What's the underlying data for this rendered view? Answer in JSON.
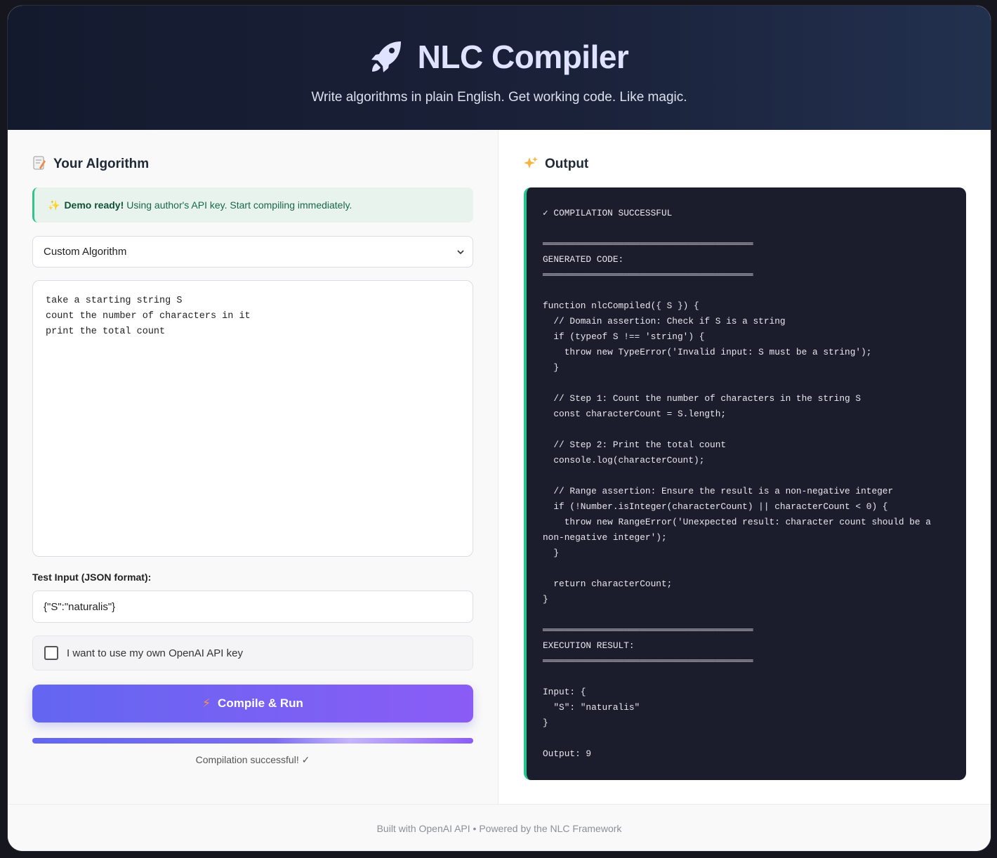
{
  "header": {
    "title": "NLC Compiler",
    "subtitle": "Write algorithms in plain English. Get working code. Like magic."
  },
  "left": {
    "section_title": "Your Algorithm",
    "section_icon": "memo-icon",
    "notice": {
      "icon": "✨",
      "bold": "Demo ready!",
      "text": "Using author's API key. Start compiling immediately."
    },
    "algorithm_select": {
      "selected": "Custom Algorithm"
    },
    "algorithm_text": "take a starting string S\ncount the number of characters in it\nprint the total count",
    "test_input_label": "Test Input (JSON format):",
    "test_input_value": "{\"S\":\"naturalis\"}",
    "own_key_checkbox": {
      "label": "I want to use my own OpenAI API key",
      "checked": false
    },
    "compile_button": {
      "icon": "⚡",
      "label": "Compile & Run"
    },
    "progress": 1.0,
    "status": "Compilation successful! ✓"
  },
  "right": {
    "section_title": "Output",
    "section_icon": "sparkles-icon",
    "output_text": "✓ COMPILATION SUCCESSFUL\n\n═══════════════════════════════════════\nGENERATED CODE:\n═══════════════════════════════════════\n\nfunction nlcCompiled({ S }) {\n  // Domain assertion: Check if S is a string\n  if (typeof S !== 'string') {\n    throw new TypeError('Invalid input: S must be a string');\n  }\n\n  // Step 1: Count the number of characters in the string S\n  const characterCount = S.length;\n\n  // Step 2: Print the total count\n  console.log(characterCount);\n\n  // Range assertion: Ensure the result is a non-negative integer\n  if (!Number.isInteger(characterCount) || characterCount < 0) {\n    throw new RangeError('Unexpected result: character count should be a non-negative integer');\n  }\n\n  return characterCount;\n}\n\n═══════════════════════════════════════\nEXECUTION RESULT:\n═══════════════════════════════════════\n\nInput: {\n  \"S\": \"naturalis\"\n}\n\nOutput: 9"
  },
  "footer": {
    "text": "Built with OpenAI API • Powered by the NLC Framework"
  },
  "colors": {
    "accent_start": "#6366f1",
    "accent_end": "#8b5cf6",
    "success": "#22c58b",
    "code_bg": "#1c1d2c"
  }
}
